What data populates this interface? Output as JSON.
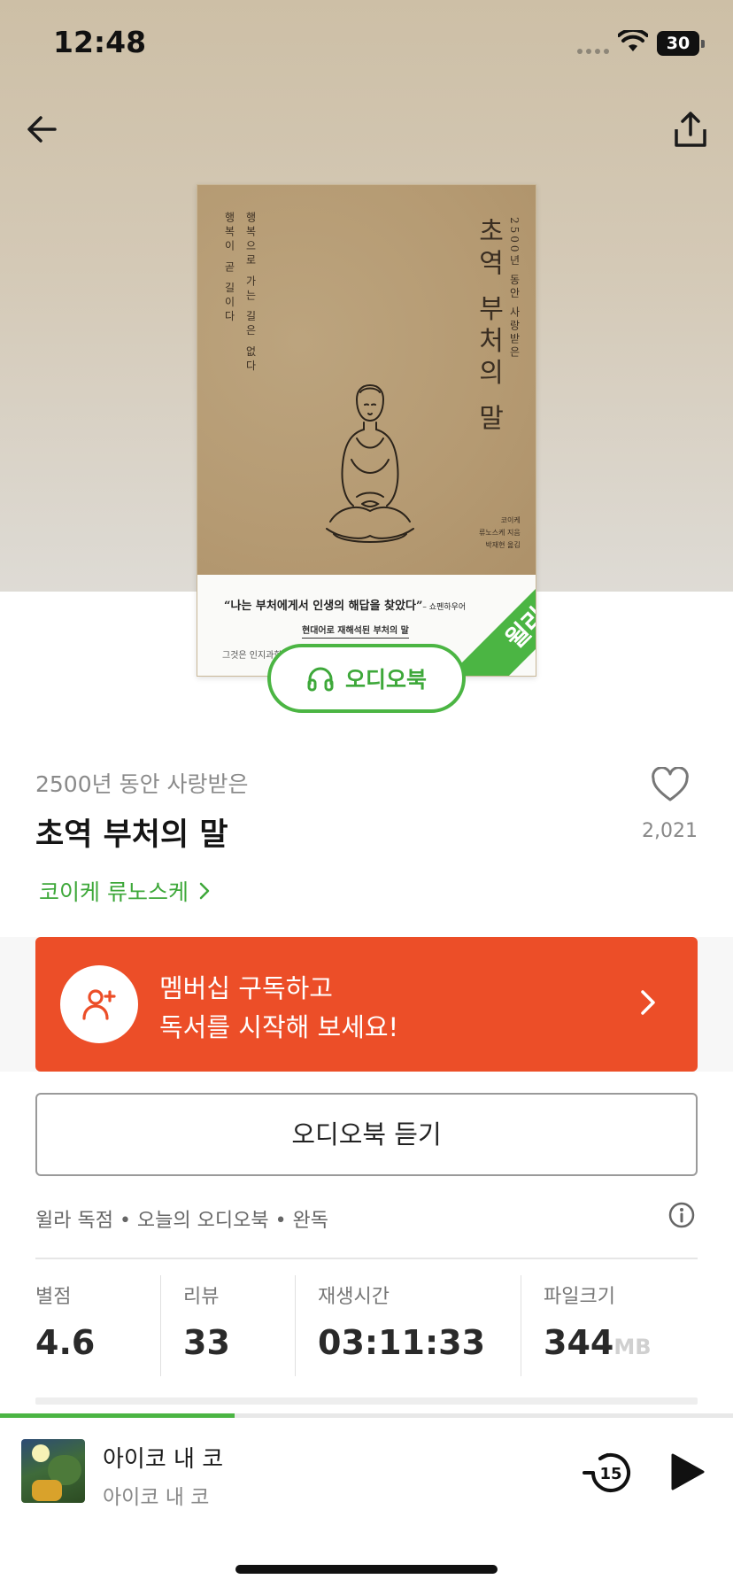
{
  "status_bar": {
    "time": "12:48",
    "battery": "30",
    "battery_level": 0.3
  },
  "nav": {
    "back_icon": "arrow-left-icon",
    "share_icon": "share-icon"
  },
  "cover": {
    "vertical_title": "초역 부처의 말",
    "vertical_subtitle": "2500년 동안 사랑받은",
    "left_line1": "행복으로 가는 길은 없다",
    "left_line2": "행복이 곧 길이다",
    "author_line1": "코이케",
    "author_line2": "류노스케 지음",
    "author_line3": "박재현 옮김",
    "quote": "“나는 부처에게서 인생의 해답을 찾았다”",
    "quote_attr": "– 쇼펜하우어",
    "tagline": "현대어로 재해석된 부처의 말",
    "footer_line": "그것은 인지과학",
    "ribbon": "윌라"
  },
  "audio_badge": {
    "label": "오디오북",
    "icon": "headphones-icon"
  },
  "book": {
    "subtitle": "2500년 동안 사랑받은",
    "title": "초역 부처의 말",
    "author": "코이케 류노스케",
    "likes": "2,021"
  },
  "promo": {
    "line1": "멤버십 구독하고",
    "line2": "독서를 시작해 보세요!",
    "color": "#ec4e28"
  },
  "listen_button": "오디오북 듣기",
  "tags": "윌라 독점 • 오늘의 오디오북 • 완독",
  "stats": {
    "rating_label": "별점",
    "rating": "4.6",
    "reviews_label": "리뷰",
    "reviews": "33",
    "duration_label": "재생시간",
    "duration": "03:11:33",
    "size_label": "파일크기",
    "size": "344",
    "size_unit": "MB"
  },
  "player": {
    "title": "아이코 내 코",
    "subtitle": "아이코 내 코",
    "rewind": "15",
    "progress": 0.32
  },
  "colors": {
    "accent": "#4bb543",
    "promo": "#ec4e28"
  }
}
